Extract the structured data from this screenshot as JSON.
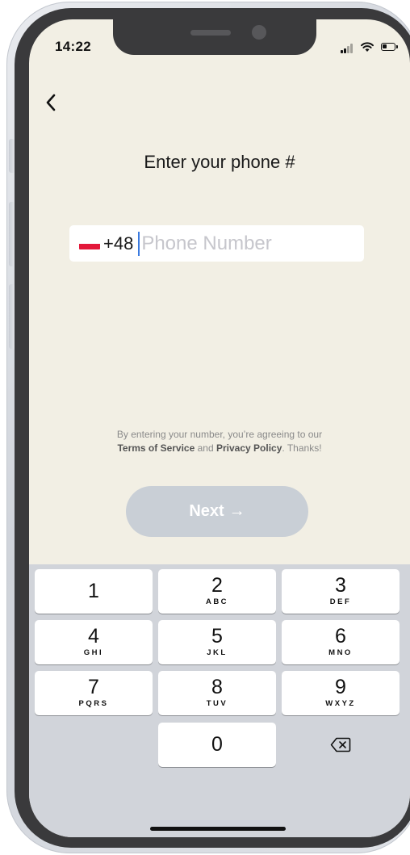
{
  "status_bar": {
    "time": "14:22"
  },
  "header": {
    "back_icon": "chevron-left-icon",
    "title": "Enter your phone #"
  },
  "phone_field": {
    "country_flag": "poland-flag-icon",
    "country_code": "+48",
    "value": "",
    "placeholder": "Phone Number"
  },
  "terms": {
    "line1": "By entering your number, you’re agreeing to our",
    "terms_link": "Terms of Service",
    "and": "and",
    "privacy_link": "Privacy Policy",
    "thanks": ". Thanks!"
  },
  "next_button": {
    "label": "Next",
    "arrow": "→",
    "color": "#c9cfd6"
  },
  "keypad": {
    "keys": [
      {
        "digit": "1",
        "letters": ""
      },
      {
        "digit": "2",
        "letters": "ABC"
      },
      {
        "digit": "3",
        "letters": "DEF"
      },
      {
        "digit": "4",
        "letters": "GHI"
      },
      {
        "digit": "5",
        "letters": "JKL"
      },
      {
        "digit": "6",
        "letters": "MNO"
      },
      {
        "digit": "7",
        "letters": "PQRS"
      },
      {
        "digit": "8",
        "letters": "TUV"
      },
      {
        "digit": "9",
        "letters": "WXYZ"
      },
      {
        "digit": "0",
        "letters": ""
      }
    ],
    "delete_icon": "backspace-icon"
  },
  "colors": {
    "screen_background": "#f2efe4",
    "keyboard_background": "#d1d4da",
    "caret": "#3b7be0"
  }
}
